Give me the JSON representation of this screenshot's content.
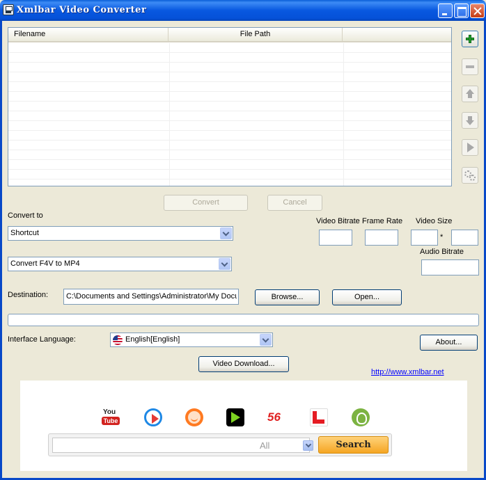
{
  "window": {
    "title": "Xmlbar Video Converter"
  },
  "filelist": {
    "columns": [
      "Filename",
      "File Path",
      ""
    ]
  },
  "actions": {
    "convert": "Convert",
    "cancel": "Cancel"
  },
  "convert_to": {
    "label": "Convert to",
    "category": "Shortcut",
    "preset": "Convert F4V to MP4"
  },
  "video_settings": {
    "bitrate_label": "Video Bitrate",
    "framerate_label": "Frame Rate",
    "size_label": "Video Size",
    "size_separator": "*",
    "audio_bitrate_label": "Audio Bitrate",
    "bitrate": "",
    "framerate": "",
    "width": "",
    "height": "",
    "audio_bitrate": ""
  },
  "destination": {
    "label": "Destination:",
    "path": "C:\\Documents and Settings\\Administrator\\My Docu",
    "browse": "Browse...",
    "open": "Open..."
  },
  "progress": {
    "value": 0
  },
  "language": {
    "label": "Interface Language:",
    "selected": "English[English]",
    "flag_icon": "us-flag-icon"
  },
  "about": "About...",
  "video_download": "Video Download...",
  "website": "http://www.xmlbar.net",
  "search_panel": {
    "sites": [
      "youtube-icon",
      "youku-icon",
      "tudou-icon",
      "iqiyi-icon",
      "56-icon",
      "letv-icon",
      "ku6-icon"
    ],
    "site_56_text": "56",
    "youtube_you": "You",
    "youtube_tube": "Tube",
    "search_query": "",
    "scope": "All",
    "search_button": "Search"
  },
  "colors": {
    "titlebar": "#0858E0",
    "link": "#0000FF",
    "search_button": "#F5A623",
    "add_icon": "#22A02E"
  }
}
